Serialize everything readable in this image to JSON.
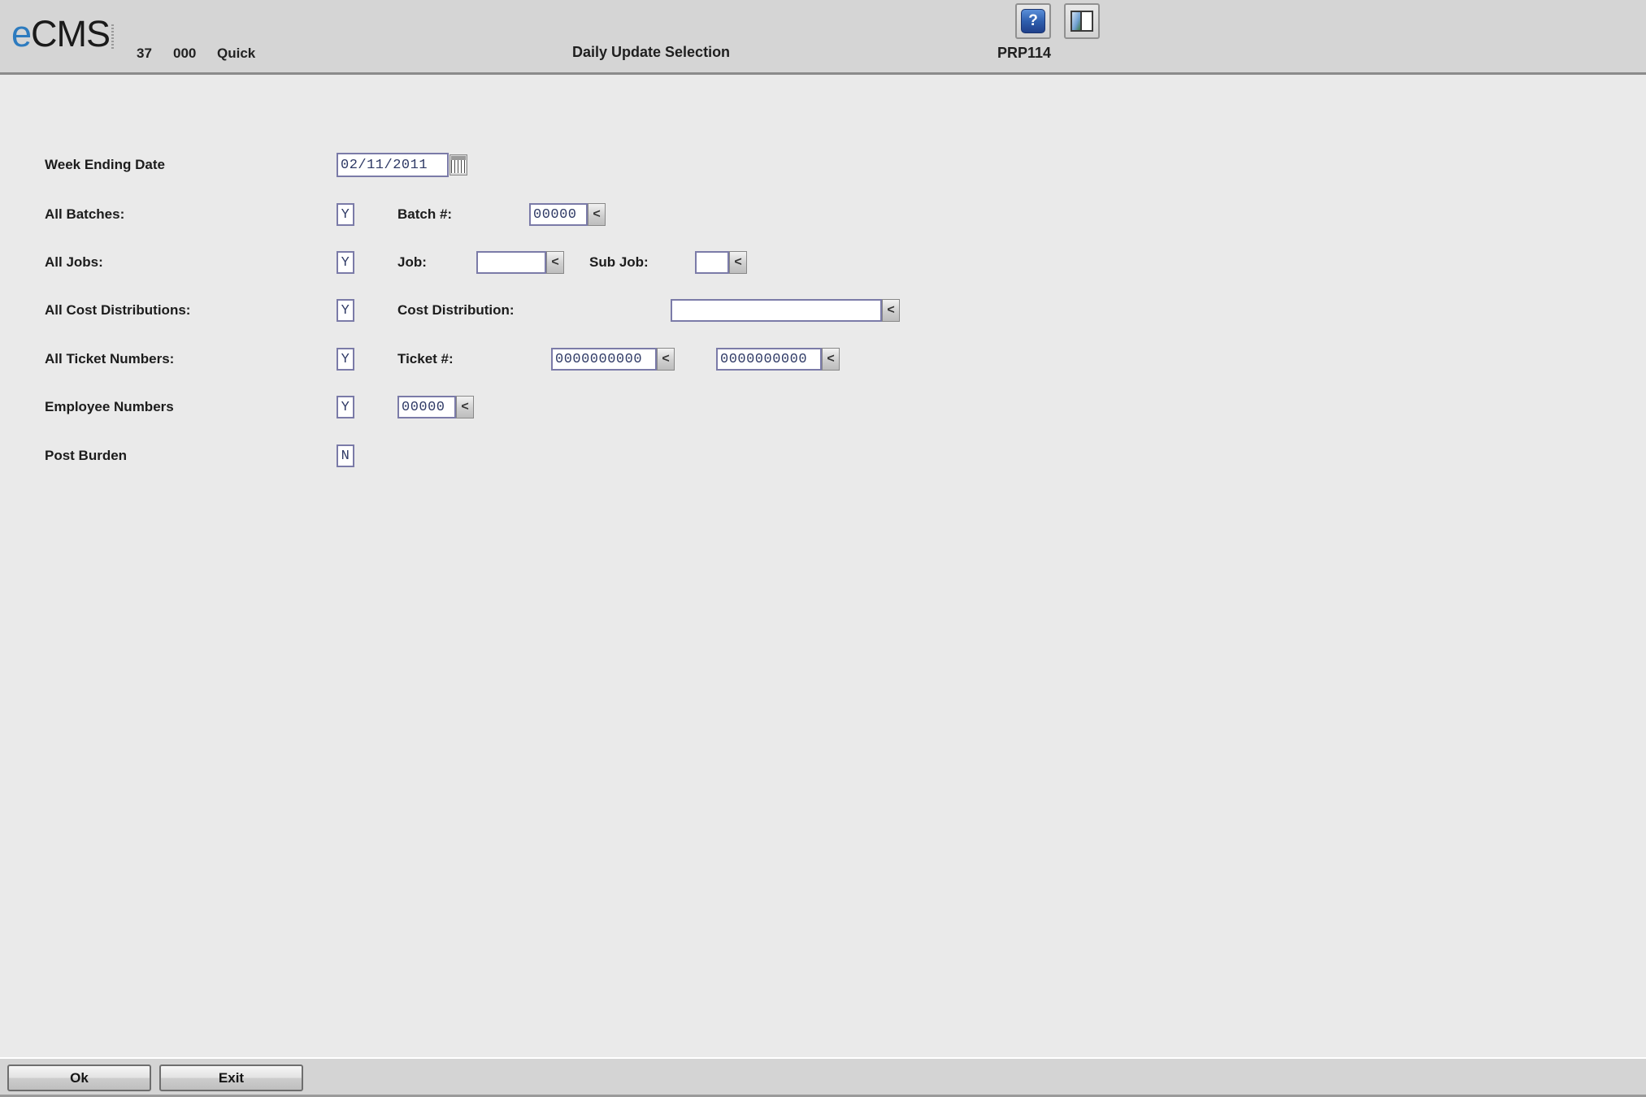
{
  "header": {
    "brand_e": "e",
    "brand_cms": "CMS",
    "company": "37",
    "division": "000",
    "user": "Quick",
    "title": "Daily Update Selection",
    "program_id": "PRP114",
    "help_icon": "help-question-icon",
    "help_glyph": "?",
    "window_icon": "split-window-icon",
    "accent_color": "#2d7bbf",
    "header_bg": "#d5d5d5"
  },
  "form": {
    "rows": [
      {
        "label": "Week Ending Date",
        "date_value": "02/11/2011"
      },
      {
        "label": "All Batches:",
        "flag": "Y",
        "inline_label": "Batch #:",
        "value": "00000",
        "lookup": "<"
      },
      {
        "label": "All Jobs:",
        "flag": "Y",
        "inline_label": "Job:",
        "job_value": "",
        "sub_label": "Sub Job:",
        "sub_value": "",
        "lookup": "<"
      },
      {
        "label": "All Cost Distributions:",
        "flag": "Y",
        "inline_label": "Cost Distribution:",
        "value": "",
        "lookup": "<"
      },
      {
        "label": "All Ticket Numbers:",
        "flag": "Y",
        "inline_label": "Ticket #:",
        "value_from": "0000000000",
        "value_to": "0000000000",
        "lookup": "<"
      },
      {
        "label": "Employee Numbers",
        "flag": "Y",
        "value": "00000",
        "lookup": "<"
      },
      {
        "label": "Post Burden",
        "flag": "N"
      }
    ]
  },
  "footer": {
    "ok_label": "Ok",
    "exit_label": "Exit"
  }
}
